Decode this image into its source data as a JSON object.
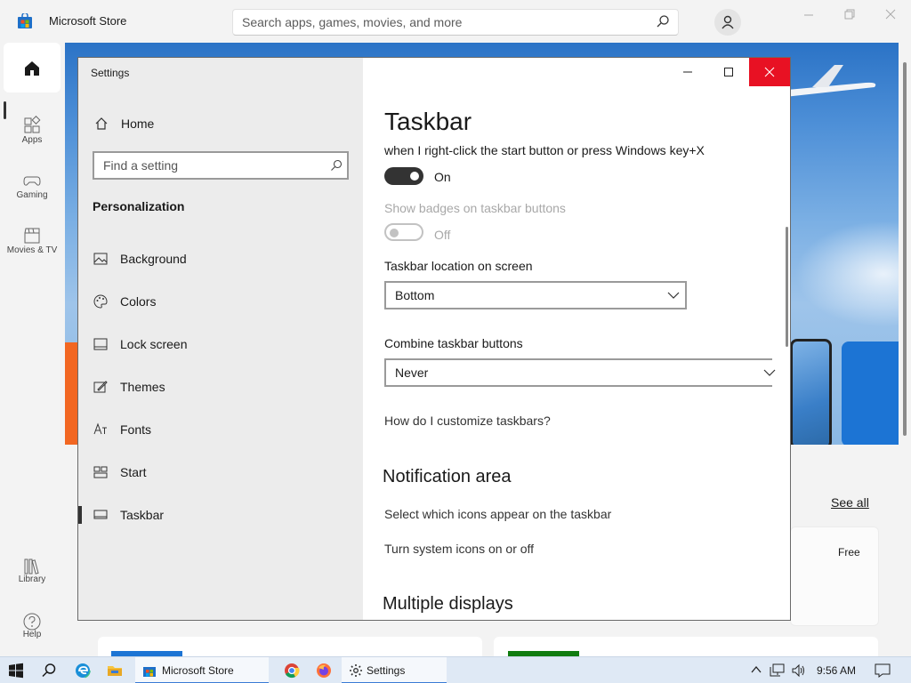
{
  "store": {
    "title": "Microsoft Store",
    "search_placeholder": "Search apps, games, movies, and more",
    "nav": [
      {
        "label": "",
        "icon": "home-icon"
      },
      {
        "label": "Apps",
        "icon": "apps-icon"
      },
      {
        "label": "Gaming",
        "icon": "gamepad-icon"
      },
      {
        "label": "Movies & TV",
        "icon": "clapperboard-icon"
      },
      {
        "label": "Library",
        "icon": "library-icon"
      },
      {
        "label": "Help",
        "icon": "help-icon"
      }
    ],
    "see_all": "See all",
    "free_badge": "Free"
  },
  "settings": {
    "window_title": "Settings",
    "home_label": "Home",
    "find_placeholder": "Find a setting",
    "section_title": "Personalization",
    "nav_items": [
      {
        "label": "Background",
        "icon": "image-icon"
      },
      {
        "label": "Colors",
        "icon": "palette-icon"
      },
      {
        "label": "Lock screen",
        "icon": "lock-screen-icon"
      },
      {
        "label": "Themes",
        "icon": "themes-icon"
      },
      {
        "label": "Fonts",
        "icon": "fonts-icon"
      },
      {
        "label": "Start",
        "icon": "start-icon"
      },
      {
        "label": "Taskbar",
        "icon": "taskbar-icon"
      }
    ],
    "active_item": "Taskbar",
    "page_title": "Taskbar",
    "jumplist_desc": "when I right-click the start button or press Windows key+X",
    "jumplist_toggle": {
      "state": "On",
      "on": true
    },
    "badges_label": "Show badges on taskbar buttons",
    "badges_toggle": {
      "state": "Off",
      "on": false,
      "disabled": true
    },
    "location_label": "Taskbar location on screen",
    "location_value": "Bottom",
    "combine_label": "Combine taskbar buttons",
    "combine_value": "Never",
    "help_link": "How do I customize taskbars?",
    "notification_heading": "Notification area",
    "notification_links": [
      "Select which icons appear on the taskbar",
      "Turn system icons on or off"
    ],
    "multiple_displays_heading": "Multiple displays"
  },
  "taskbar": {
    "apps": [
      {
        "label": "Microsoft Store",
        "icon": "store-icon"
      },
      {
        "label": "Settings",
        "icon": "gear-icon"
      }
    ],
    "clock": "9:56 AM"
  },
  "colors": {
    "accent": "#3a7bd5",
    "close_red": "#e81123",
    "toggle_on": "#333333"
  }
}
